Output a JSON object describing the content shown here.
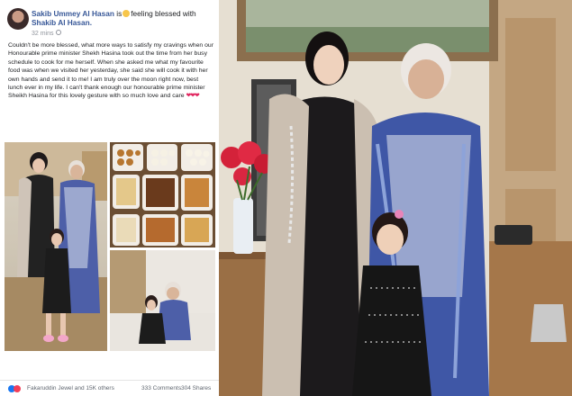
{
  "post": {
    "author": "Sakib Ummey Al Hasan",
    "is_text": "is",
    "feeling": "feeling blessed with",
    "tagged": "Shakib Al Hasan.",
    "time": "32 mins",
    "body": "Couldn't be more blessed, what more ways to satisfy my cravings when our Honourable prime minister Shekh Hasina took out the time from her busy schedule to cook for me herself. When she asked me what my favourite food was when we visited her yesterday, she said she will cook it with her own hands and send it to me! I am truly over the moon right now, best lunch ever in my life. I can't thank enough our honourable prime minister Sheikh Hasina for this lovely gesture with so much love and care",
    "hearts": "❤❤❤"
  },
  "footer": {
    "reactions": "Fakaruddin Jewel and 15K others",
    "comments": "333 Comments",
    "shares": "304 Shares"
  },
  "colors": {
    "link": "#385898",
    "heart": "#e0245e",
    "like": "#1877f2"
  }
}
